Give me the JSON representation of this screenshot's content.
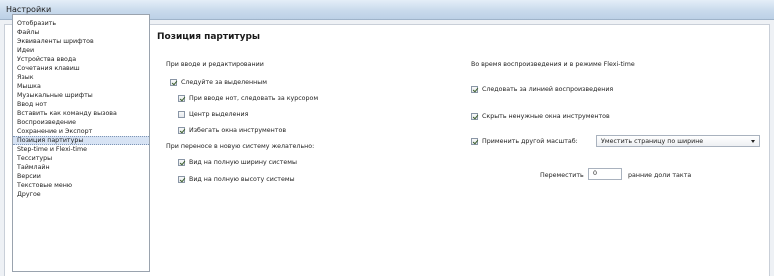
{
  "window": {
    "title": "Настройки"
  },
  "sidebar": {
    "items": [
      {
        "label": "Отобразить"
      },
      {
        "label": "Файлы"
      },
      {
        "label": "Эквиваленты шрифтов"
      },
      {
        "label": "Идеи"
      },
      {
        "label": "Устройства ввода"
      },
      {
        "label": "Сочетания клавиш"
      },
      {
        "label": "Язык"
      },
      {
        "label": "Мышка"
      },
      {
        "label": "Музыкальные шрифты"
      },
      {
        "label": "Ввод нот"
      },
      {
        "label": "Вставить как команду вызова"
      },
      {
        "label": "Воспроизведение"
      },
      {
        "label": "Сохранение и Экспорт"
      },
      {
        "label": "Позиция партитуры"
      },
      {
        "label": "Step-time и Flexi-time"
      },
      {
        "label": "Тесситуры"
      },
      {
        "label": "Таймлайн"
      },
      {
        "label": "Версии"
      },
      {
        "label": "Текстовые меню"
      },
      {
        "label": "Другое"
      }
    ],
    "selected_index": 13
  },
  "main": {
    "heading": "Позиция партитуры",
    "left": {
      "group1_label": "При вводе и редактировании",
      "follow_selection": {
        "label": "Следуйте за выделенным",
        "checked": true
      },
      "follow_cursor": {
        "label": "При вводе нот, следовать за курсором",
        "checked": true
      },
      "center_selection": {
        "label": "Центр выделения",
        "checked": false
      },
      "avoid_windows": {
        "label": "Избегать окна инструментов",
        "checked": true
      },
      "group2_label": "При переносе в новую систему желательно:",
      "full_width": {
        "label": "Вид на полную ширину системы",
        "checked": true
      },
      "full_height": {
        "label": "Вид на полную высоту системы",
        "checked": true
      }
    },
    "right": {
      "group_label": "Во время воспроизведения и в режиме Flexi-time",
      "follow_line": {
        "label": "Следовать за линией воспроизведения",
        "checked": true
      },
      "hide_windows": {
        "label": "Скрыть ненужные окна инструментов",
        "checked": true
      },
      "apply_zoom": {
        "label": "Применить другой масштаб:",
        "checked": true
      },
      "zoom_select": {
        "value": "Уместить страницу по ширине"
      },
      "move_label": "Переместить",
      "move_value": "0",
      "move_suffix": "ранние доли такта"
    }
  }
}
